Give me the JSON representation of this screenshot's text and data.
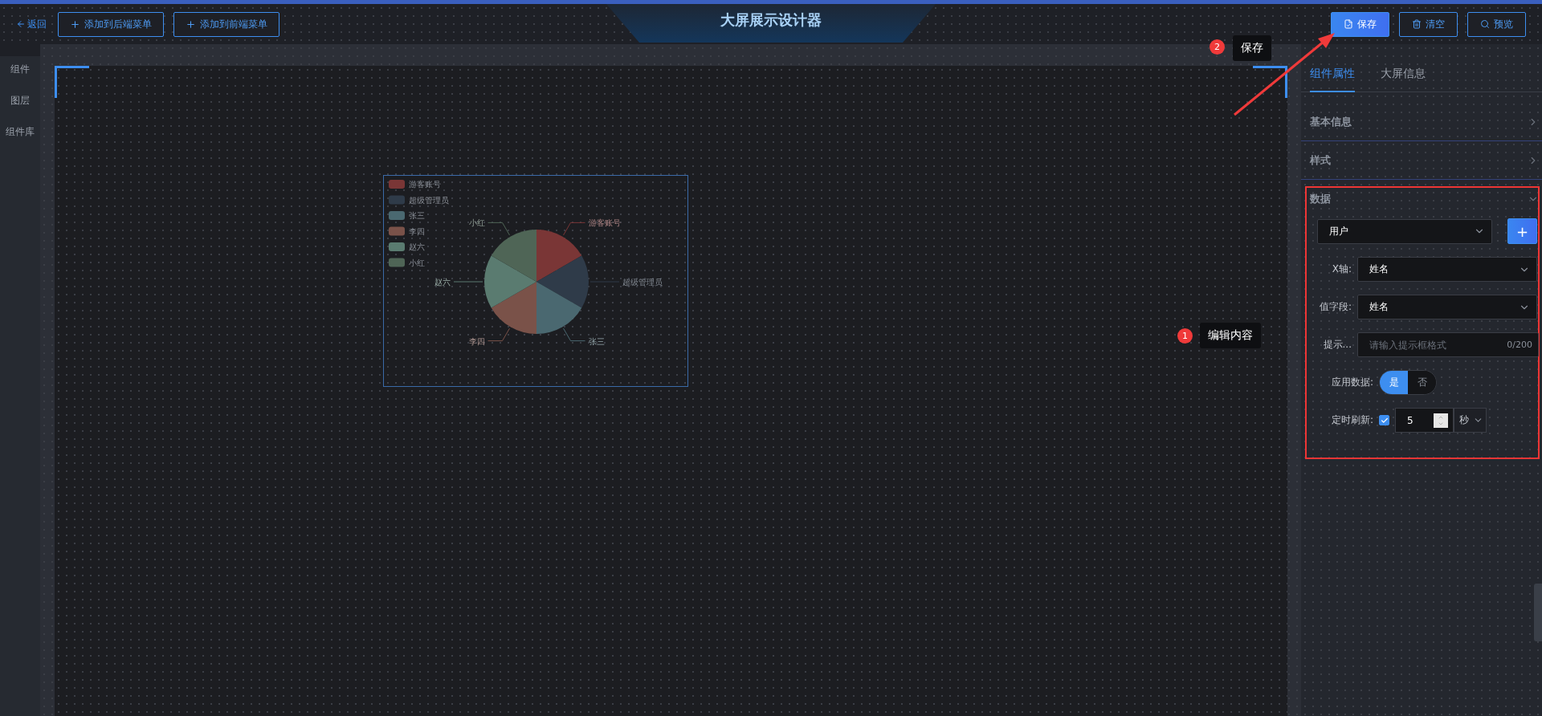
{
  "header": {
    "back": "返回",
    "menu_buttons": [
      "添加到后端菜单",
      "添加到前端菜单"
    ],
    "title": "大屏展示设计器",
    "actions": [
      {
        "label": "保存",
        "kind": "primary"
      },
      {
        "label": "清空",
        "kind": "outline"
      },
      {
        "label": "预览",
        "kind": "outline"
      }
    ]
  },
  "sidebar": {
    "items": [
      "组件",
      "图层",
      "组件库"
    ]
  },
  "canvas": {
    "chart": {
      "items": [
        {
          "legend": "游客账号",
          "label": "游客账号",
          "color": "#7a3636"
        },
        {
          "legend": "超级管理员",
          "label": "超级管理员",
          "color": "#2f3b49"
        },
        {
          "legend": "张三",
          "label": "张三",
          "color": "#4a6870"
        },
        {
          "legend": "李四",
          "label": "李四",
          "color": "#7a5249"
        },
        {
          "legend": "赵六",
          "label": "赵六",
          "color": "#5a7b70"
        },
        {
          "legend": "小红",
          "label": "小红",
          "color": "#4f6556"
        }
      ]
    }
  },
  "panel": {
    "tabs": [
      {
        "label": "组件属性",
        "selected": true
      },
      {
        "label": "大屏信息",
        "selected": false
      }
    ],
    "sections": [
      {
        "title": "基本信息",
        "expanded": false
      },
      {
        "title": "样式",
        "expanded": false
      },
      {
        "title": "数据",
        "expanded": true
      }
    ],
    "data_form": {
      "source": {
        "value": "用户"
      },
      "add_button": "+",
      "fields": [
        {
          "label": "X轴:",
          "kind": "select",
          "value": "姓名"
        },
        {
          "label": "值字段:",
          "kind": "select",
          "value": "姓名"
        },
        {
          "label": "提示...",
          "kind": "text",
          "placeholder": "请输入提示框格式",
          "counter": "0/200"
        }
      ],
      "apply_data": {
        "label": "应用数据:",
        "options": [
          {
            "label": "是",
            "selected": true
          },
          {
            "label": "否",
            "selected": false
          }
        ]
      },
      "refresh": {
        "label": "定时刷新:",
        "checked": true,
        "value": "5",
        "unit": "秒"
      }
    }
  },
  "annotations": [
    {
      "number": "2",
      "text": "保存"
    },
    {
      "number": "1",
      "text": "编辑内容"
    }
  ]
}
